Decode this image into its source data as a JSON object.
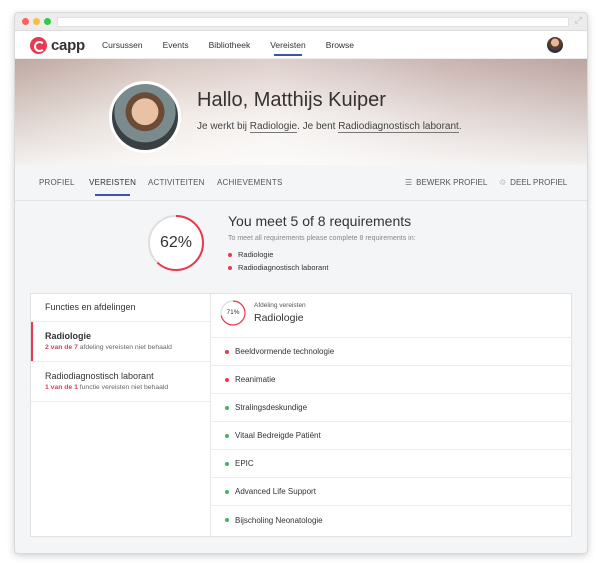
{
  "app": {
    "logo_text": "capp"
  },
  "nav": {
    "items": [
      "Cursussen",
      "Events",
      "Bibliotheek",
      "Vereisten",
      "Browse"
    ],
    "active": "Vereisten"
  },
  "hero": {
    "greeting": "Hallo, Matthijs Kuiper",
    "sub_prefix": "Je werkt bij ",
    "department": "Radiologie",
    "sub_middle": ". Je bent ",
    "role": "Radiodiagnostisch laborant",
    "sub_suffix": "."
  },
  "tabs": {
    "items": [
      "PROFIEL",
      "VEREISTEN",
      "ACTIVITEITEN",
      "ACHIEVEMENTS"
    ],
    "active": "VEREISTEN",
    "edit_label": "BEWERK PROFIEL",
    "share_label": "DEEL PROFIEL"
  },
  "summary": {
    "percent_label": "62%",
    "percent": 62,
    "title": "You meet 5 of 8 requirements",
    "hint": "To meet all requirements please complete 8 requirements in:",
    "items": [
      "Radiologie",
      "Radiodiagnostisch laborant"
    ]
  },
  "left": {
    "header": "Functies en afdelingen",
    "items": [
      {
        "title": "Radiologie",
        "count": "2 van de 7",
        "rest": " afdeling vereisten niet behaald"
      },
      {
        "title": "Radiodiagnostisch laborant",
        "count": "1 van de 1",
        "rest": " functie vereisten niet behaald"
      }
    ]
  },
  "right": {
    "percent_label": "71%",
    "percent": 71,
    "kicker": "Afdeling vereisten",
    "title": "Radiologie",
    "requirements": [
      {
        "label": "Beeldvormende technologie",
        "status": "missing"
      },
      {
        "label": "Reanimatie",
        "status": "missing"
      },
      {
        "label": "Stralingsdeskundige",
        "status": "met"
      },
      {
        "label": "Vitaal Bedreigde Patiënt",
        "status": "met"
      },
      {
        "label": "EPIC",
        "status": "met"
      },
      {
        "label": "Advanced Life Support",
        "status": "met"
      },
      {
        "label": "Bijscholing Neonatologie",
        "status": "met"
      }
    ]
  },
  "colors": {
    "accent": "#e8394f",
    "ok": "#3fb46b",
    "nav_active": "#3f51b5"
  }
}
